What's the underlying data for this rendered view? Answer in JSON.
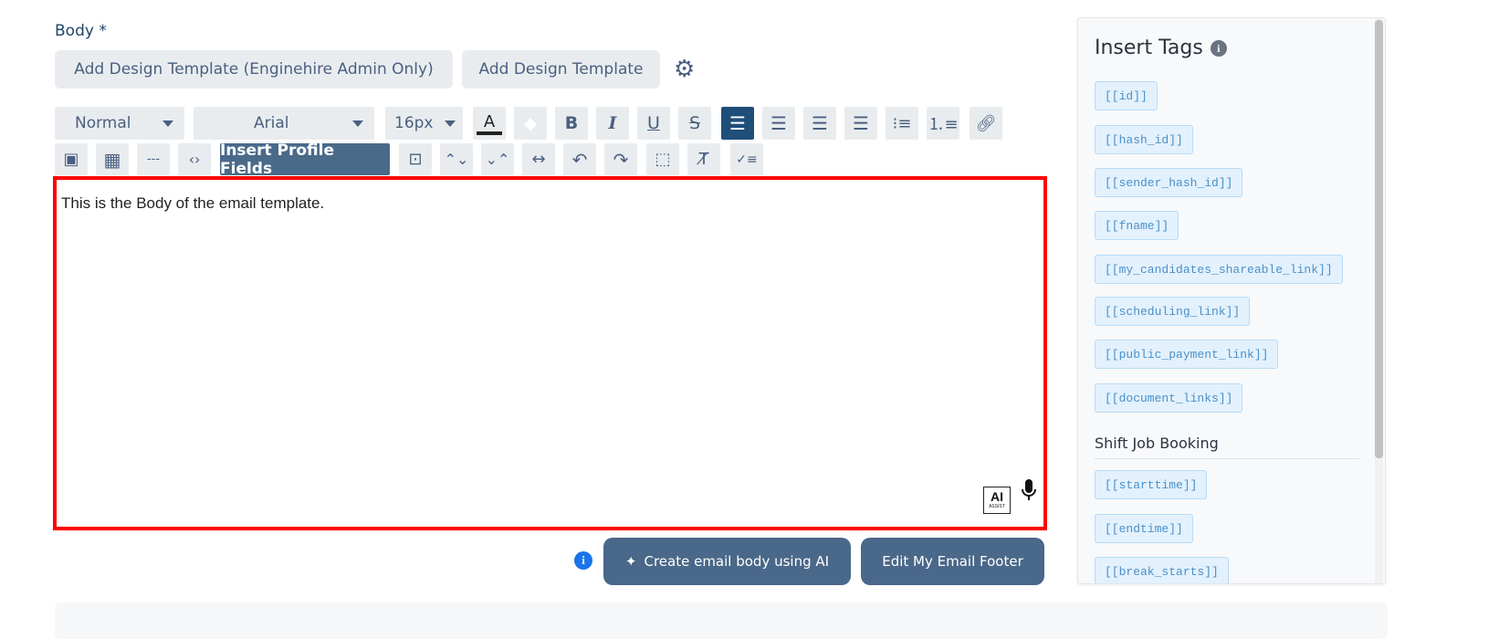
{
  "body_label": "Body *",
  "template_buttons": [
    "Add Design Template (Enginehire Admin Only)",
    "Add Design Template"
  ],
  "toolbar": {
    "format": "Normal",
    "font": "Arial",
    "size": "16px",
    "insert_profile_fields": "Insert Profile Fields",
    "hr_label": "---"
  },
  "editor": {
    "content": "This is the Body of the email template.",
    "ai_label": "AI",
    "ai_sub": "ASSIST"
  },
  "actions": {
    "create_ai": "Create email body using AI",
    "edit_footer": "Edit My Email Footer"
  },
  "panel": {
    "title": "Insert Tags",
    "tags": [
      "[[id]]",
      "[[hash_id]]",
      "[[sender_hash_id]]",
      "[[fname]]",
      "[[my_candidates_shareable_link]]",
      "[[scheduling_link]]",
      "[[public_payment_link]]",
      "[[document_links]]"
    ],
    "section": "Shift Job Booking",
    "section_tags": [
      "[[starttime]]",
      "[[endtime]]",
      "[[break_starts]]"
    ]
  },
  "colors": {
    "accent": "#1f4e79",
    "button": "#4a6889",
    "editor_border": "#ff0000",
    "tag_bg": "#e3f1fd"
  }
}
